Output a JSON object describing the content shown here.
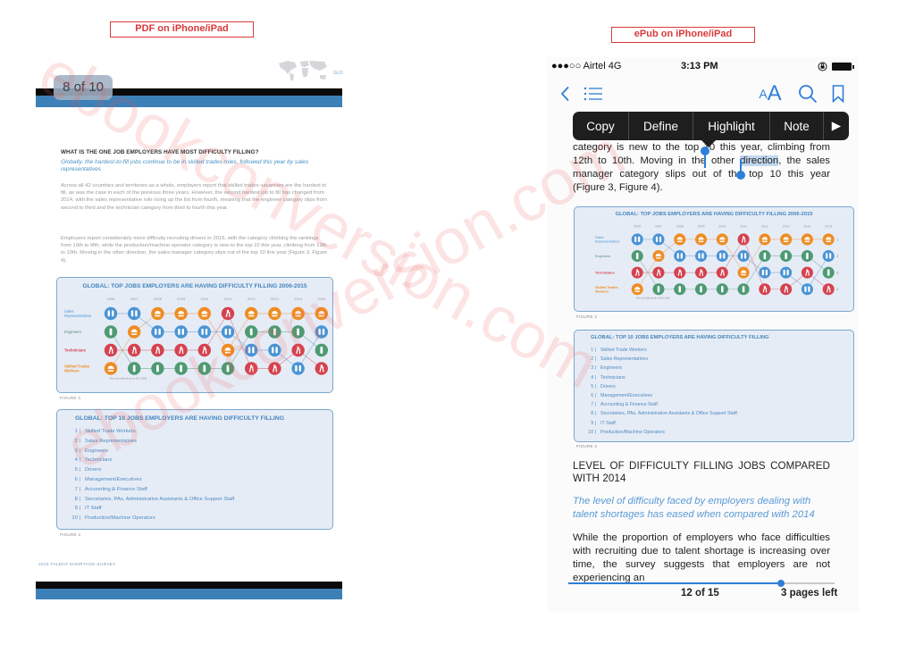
{
  "captions": {
    "pdf": "PDF on iPhone/iPad",
    "epub": "ePub on iPhone/iPad"
  },
  "watermark": "ebookconversion.com",
  "colors": {
    "accent_blue": "#2f7ed8",
    "pdf_band_blue": "#3c80b7",
    "caption_red": "#d93a3a",
    "sales": "#4a94d4",
    "engineers": "#4e9a73",
    "technicians": "#d4434f",
    "skilled_trades": "#ee8d24"
  },
  "pdf": {
    "page_indicator": "8 of 10",
    "header_mark": "GLO",
    "heading": "WHAT IS THE ONE JOB EMPLOYERS HAVE MOST DIFFICULTY FILLING?",
    "subheading": "Globally, the hardest-to-fill jobs continue to be in skilled trades roles, followed this year by sales representatives",
    "paragraph1": "Across all 42 countries and territories as a whole, employers report that skilled trades vacancies are the hardest to fill, as was the case in each of the previous three years. However, the second hardest job to fill has changed from 2014, with the sales representative role rising up the list from fourth, meaning that the engineer category slips from second to third and the technician category from third to fourth this year.",
    "paragraph2": "Employers report considerably more difficulty recruiting drivers in 2015, with the category climbing the rankings from 10th to fifth, while the production/machine operator category is new to the top 10 this year, climbing from 12th to 10th. Moving in the other direction, the sales manager category slips out of the top 10 this year (Figure 3, Figure 4).",
    "figure3_caption": "FIGURE 3",
    "figure4_caption": "FIGURE 4",
    "footer": "2015 TALENT SHORTAGE SURVEY"
  },
  "chart_data": {
    "type": "table",
    "title": "GLOBAL: TOP JOBS EMPLOYERS ARE HAVING DIFFICULTY FILLING 2006-2015",
    "x": [
      "2006",
      "2007",
      "2008",
      "2009",
      "2010",
      "2011",
      "2012",
      "2013",
      "2014",
      "2015"
    ],
    "row_labels": [
      "Sales Representatives",
      "Engineers",
      "Technicians",
      "Skilled Trades Workers"
    ],
    "rank_labels": [
      "1",
      "2",
      "3",
      "4"
    ],
    "footnote": "*4th most difficult job to fill in 2006",
    "series": [
      {
        "name": "Sales Representatives",
        "key": "S",
        "ranks": [
          1,
          1,
          2,
          2,
          2,
          2,
          3,
          3,
          4,
          2
        ]
      },
      {
        "name": "Engineers",
        "key": "E",
        "ranks": [
          2,
          4,
          4,
          4,
          4,
          4,
          2,
          2,
          2,
          3
        ]
      },
      {
        "name": "Technicians",
        "key": "T",
        "ranks": [
          3,
          3,
          3,
          3,
          3,
          1,
          4,
          4,
          3,
          4
        ]
      },
      {
        "name": "Skilled Trades Workers",
        "key": "K",
        "ranks": [
          4,
          2,
          1,
          1,
          1,
          3,
          1,
          1,
          1,
          1
        ]
      }
    ]
  },
  "top10": {
    "title": "GLOBAL: TOP 10 JOBS EMPLOYERS ARE HAVING DIFFICULTY FILLING",
    "items": [
      {
        "num": "1",
        "label": "Skilled Trade Workers"
      },
      {
        "num": "2",
        "label": "Sales Representatives"
      },
      {
        "num": "3",
        "label": "Engineers"
      },
      {
        "num": "4",
        "label": "Technicians"
      },
      {
        "num": "5",
        "label": "Drivers"
      },
      {
        "num": "6",
        "label": "Management/Executives"
      },
      {
        "num": "7",
        "label": "Accounting & Finance Staff"
      },
      {
        "num": "8",
        "label": "Secretaries, PAs, Administrative Assistants & Office Support Staff"
      },
      {
        "num": "9",
        "label": "IT Staff"
      },
      {
        "num": "10",
        "label": "Production/Machine Operators"
      }
    ]
  },
  "epub": {
    "status": {
      "carrier": "●●●○○ Airtel  4G",
      "time": "3:13 PM"
    },
    "nav": {
      "back_icon": "chevron-left",
      "toc_icon": "list",
      "font_small": "A",
      "font_large": "A",
      "search_icon": "magnifier",
      "bookmark_icon": "bookmark"
    },
    "context_menu": [
      "Copy",
      "Define",
      "Highlight",
      "Note",
      "▶"
    ],
    "para1_before": "category is new to the top 10 this year, climbing from 12th to 10th. Moving in the other ",
    "para1_selected": "direction",
    "para1_after": ", the sales manager category slips out of the top 10 this year (Figure 3, Figure 4).",
    "figure3_caption": "FIGURE 3",
    "figure4_caption": "FIGURE 4",
    "heading": "LEVEL OF DIFFICULTY FILLING JOBS COMPARED WITH 2014",
    "subheading": "The level of difficulty faced by employers dealing with talent shortages has eased when compared with 2014",
    "para2": "While the proportion of employers who face difficulties with recruiting due to talent shortage is increasing over time, the survey suggests that employers are not experiencing an",
    "progress_fraction": 0.8,
    "page_label": "12 of 15",
    "pages_left": "3 pages left"
  }
}
